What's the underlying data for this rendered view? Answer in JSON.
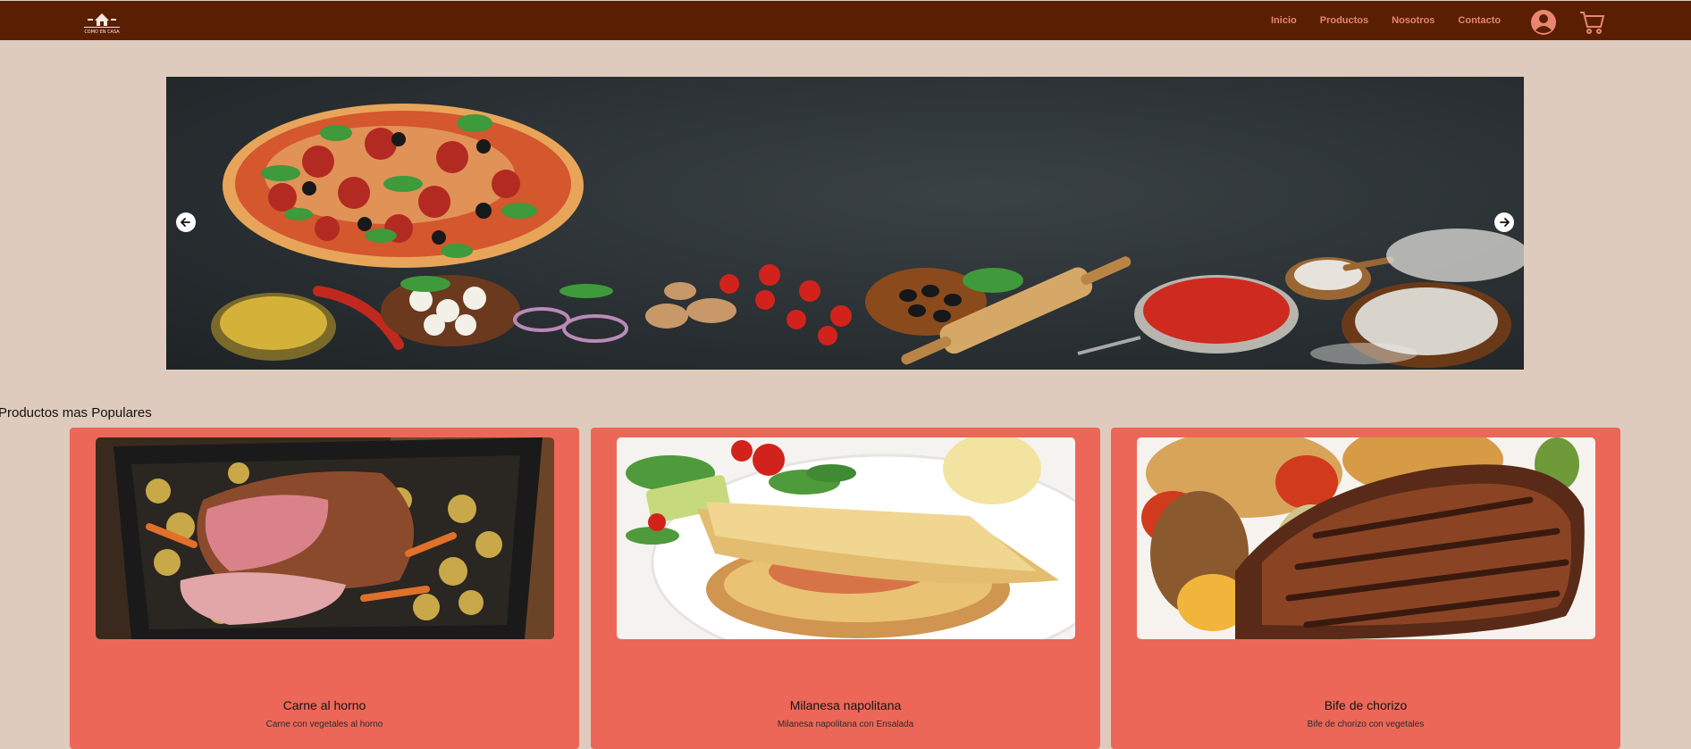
{
  "brand": {
    "logo_text": "COMO EN CASA"
  },
  "nav": {
    "links": [
      "Inicio",
      "Productos",
      "Nosotros",
      "Contacto"
    ],
    "link_color": "#e8866f",
    "bg_color": "#5a1e03"
  },
  "icons": {
    "user": "user-circle-icon",
    "cart": "shopping-cart-icon",
    "prev": "arrow-left-icon",
    "next": "arrow-right-icon"
  },
  "popular": {
    "title": "Productos mas Populares",
    "card_color": "#ec6758",
    "products": [
      {
        "name": "Carne al horno",
        "description": "Carne con vegetales al horno"
      },
      {
        "name": "Milanesa napolitana",
        "description": "Milanesa napolitana con Ensalada"
      },
      {
        "name": "Bife de chorizo",
        "description": "Bife de chorizo con vegetales"
      }
    ]
  }
}
